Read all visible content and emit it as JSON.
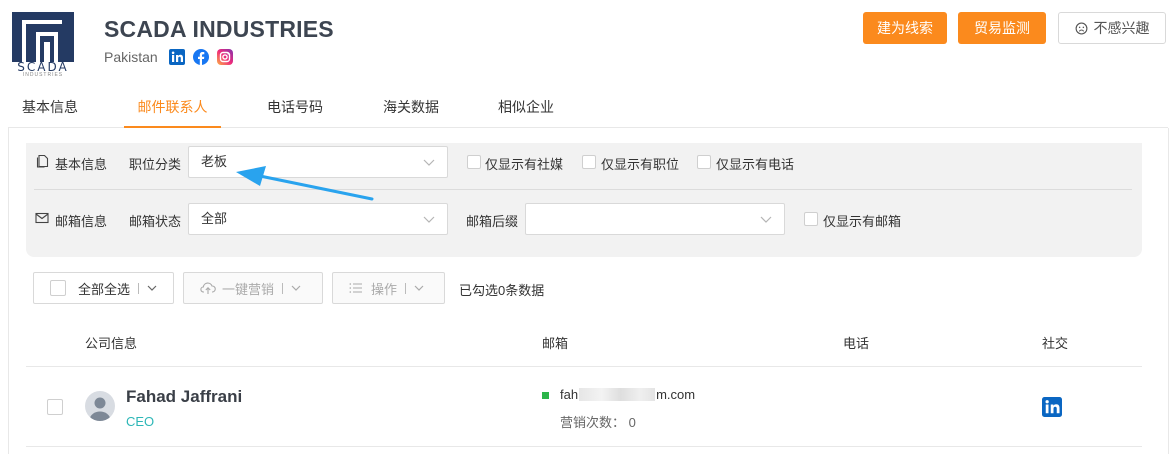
{
  "company": {
    "name": "SCADA INDUSTRIES",
    "country": "Pakistan",
    "logo_text": "SCADA",
    "logo_subtext": "INDUSTRIES"
  },
  "header_buttons": {
    "lead": "建为线索",
    "trade": "贸易监测",
    "not_interested": "不感兴趣"
  },
  "tabs": [
    {
      "label": "基本信息"
    },
    {
      "label": "邮件联系人"
    },
    {
      "label": "电话号码"
    },
    {
      "label": "海关数据"
    },
    {
      "label": "相似企业"
    }
  ],
  "filters": {
    "basic_info_label": "基本信息",
    "position_label": "职位分类",
    "position_value": "老板",
    "only_social": "仅显示有社媒",
    "only_position": "仅显示有职位",
    "only_phone": "仅显示有电话",
    "email_info_label": "邮箱信息",
    "email_status_label": "邮箱状态",
    "email_status_value": "全部",
    "email_suffix_label": "邮箱后缀",
    "email_suffix_value": "",
    "only_email": "仅显示有邮箱"
  },
  "toolbar": {
    "select_all": "全部全选",
    "one_click_marketing": "一键营销",
    "operations": "操作",
    "selected_count": "已勾选0条数据"
  },
  "table": {
    "headers": [
      "公司信息",
      "邮箱",
      "电话",
      "社交"
    ],
    "rows": [
      {
        "name": "Fahad Jaffrani",
        "title": "CEO",
        "email_prefix": "fah",
        "email_suffix": "m.com",
        "marketing_count": "营销次数：  0",
        "phone": ""
      }
    ]
  },
  "colors": {
    "accent": "#fb8a1d",
    "title_teal": "#2db7b7",
    "valid_email": "#2cb54a",
    "annotation_arrow": "#29a3ee"
  }
}
